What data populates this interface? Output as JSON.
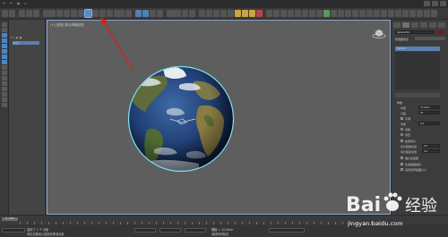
{
  "viewport": {
    "label": "[+] [透视] [默认明暗处理]"
  },
  "command_panel": {
    "tabs": [
      "create",
      "modify",
      "hierarchy",
      "motion",
      "display",
      "utilities"
    ],
    "object_name": "Sphere001",
    "color_hex": "#6d1b1b",
    "modifier_list_label": "修改器列表",
    "modifier_item": "Sphere",
    "params": {
      "section": "参数",
      "radius_label": "半径",
      "radius_value": "75.0mm",
      "segments_label": "分段",
      "segments_value": "32",
      "smooth_label": "平滑",
      "hemisphere_label": "半球",
      "hemisphere_value": "0.0",
      "chop_label": "切除",
      "squash_label": "挤压",
      "slice_on_label": "启用切片",
      "slice_from_label": "切片起始位置",
      "slice_from_value": "0.0",
      "slice_to_label": "切片结束位置",
      "slice_to_value": "0.0",
      "base_to_pivot_label": "轴心在底部",
      "gen_map_coords_label": "生成贴图坐标",
      "real_world_label": "真实世界贴图大小"
    }
  },
  "timeline": {
    "slider_label": "0 / 100"
  },
  "statusbar": {
    "selection": "选择了 1 个 对象",
    "prompt": "单击并拖动以选择并移动对象",
    "grid": "栅格 = 10.0mm",
    "add_time_tag": "添加时间标记"
  },
  "watermark": {
    "brand": "Baidu 经验",
    "url": "jingyan.baidu.com"
  },
  "colors": {
    "selection_blue": "#5d89c7",
    "arrow_red": "#d22222",
    "viewport_bg": "#5e5e5e"
  }
}
